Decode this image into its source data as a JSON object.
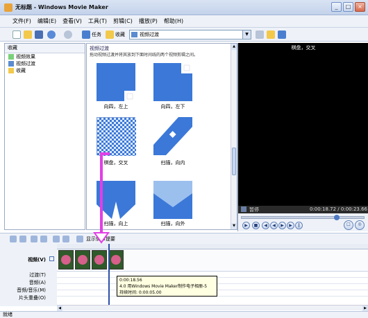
{
  "window": {
    "title": "无标题 - Windows Movie Maker",
    "controls": [
      "_",
      "□",
      "×"
    ]
  },
  "menu": [
    "文件(F)",
    "编辑(E)",
    "查看(V)",
    "工具(T)",
    "剪辑(C)",
    "播放(P)",
    "帮助(H)"
  ],
  "toolbar": {
    "tasks_label": "任务",
    "collections_label": "收藏",
    "collection_select": "视频过渡"
  },
  "left_pane": {
    "header": "收藏",
    "items": [
      "视频效果",
      "视频过渡",
      "收藏"
    ]
  },
  "content": {
    "title": "视频过渡",
    "description": "拖动视频过渡并将其放到下面时间线的两个视频剪辑之间。",
    "tiles": [
      {
        "label": "向四，左上"
      },
      {
        "label": "向四，左下"
      },
      {
        "label": "棋盘，交叉"
      },
      {
        "label": "扫描，向内"
      },
      {
        "label": "扫描，向上"
      },
      {
        "label": "扫描，向外"
      }
    ]
  },
  "monitor": {
    "title": "棋盘，交叉",
    "state": "暂停",
    "time": "0:00:18.72 / 0:00:23.66",
    "seek_fraction": 0.78
  },
  "timeline": {
    "toolbar_label": "显示情节提要",
    "tracks": [
      "视频(V)",
      "过渡(T)",
      "音频(A)",
      "音频/音乐(M)",
      "片头重叠(O)"
    ]
  },
  "tooltip": {
    "line1": "0:00:18.56",
    "line2": "4.0 用Windows Movie Maker制作电子相册-5",
    "line3": "持续时间: 0:00:05.00"
  },
  "status": "就绪",
  "colors": {
    "accent": "#e23ee6",
    "tile_blue": "#3b78d8"
  }
}
